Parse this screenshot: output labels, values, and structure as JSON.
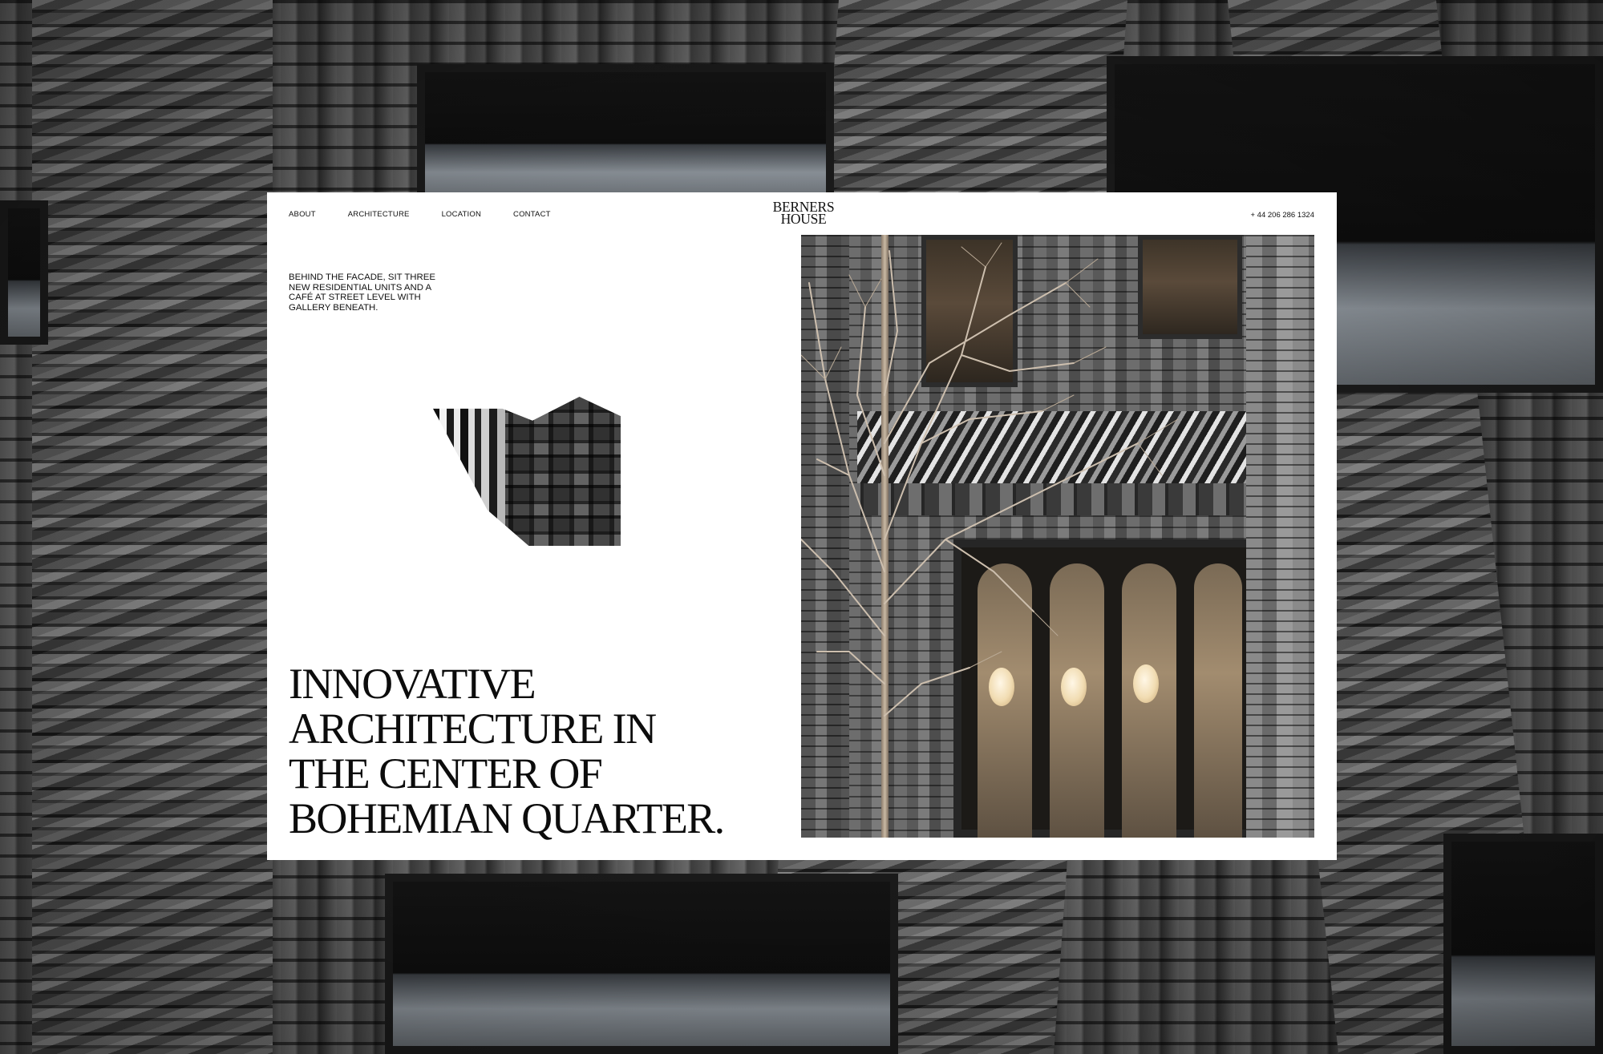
{
  "nav": {
    "items": [
      "ABOUT",
      "ARCHITECTURE",
      "LOCATION",
      "CONTACT"
    ]
  },
  "logo": {
    "line1": "BERNERS",
    "line2": "HOUSE"
  },
  "phone": "+ 44 206 286 1324",
  "intro": "BEHIND THE FACADE, SIT THREE NEW RESIDENTIAL UNITS AND A CAFÉ AT STREET LEVEL WITH GALLERY BENEATH.",
  "headline": {
    "line1": "INNOVATIVE",
    "line2": "ARCHITECTURE IN",
    "line3": "THE CENTER OF",
    "line4": "BOHEMIAN QUARTER."
  },
  "colors": {
    "page_background": "#ffffff",
    "text": "#111111"
  },
  "icons": {
    "hero_image": "building-facade-photo",
    "fragment_image": "facade-fragment-cutout"
  }
}
